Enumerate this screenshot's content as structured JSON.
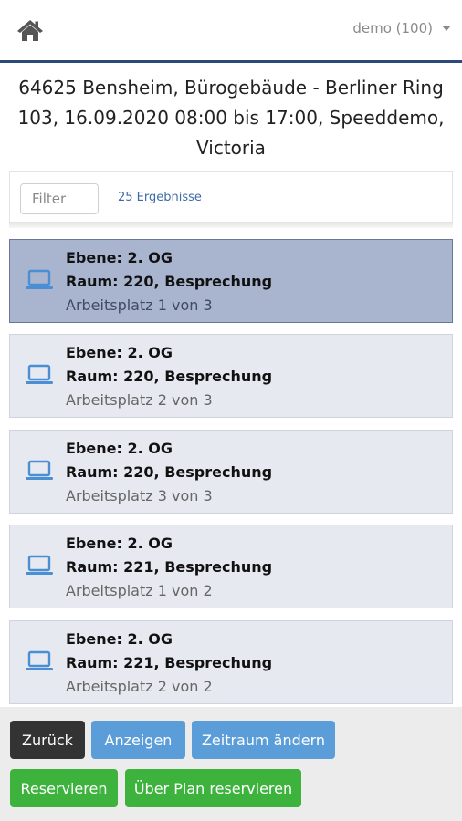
{
  "header": {
    "user_menu_label": "demo (100)"
  },
  "title": {
    "line1": "64625 Bensheim, Bürogebäude - Berliner Ring",
    "line2": "103, 16.09.2020 08:00 bis 17:00, Speeddemo,",
    "line3": "Victoria"
  },
  "filter": {
    "placeholder": "Filter",
    "value": "",
    "result_count": "25 Ergebnisse"
  },
  "workplaces": [
    {
      "ebene": "Ebene: 2. OG",
      "raum": "Raum: 220, Besprechung",
      "platz": "Arbeitsplatz 1 von 3",
      "selected": true
    },
    {
      "ebene": "Ebene: 2. OG",
      "raum": "Raum: 220, Besprechung",
      "platz": "Arbeitsplatz 2 von 3",
      "selected": false
    },
    {
      "ebene": "Ebene: 2. OG",
      "raum": "Raum: 220, Besprechung",
      "platz": "Arbeitsplatz 3 von 3",
      "selected": false
    },
    {
      "ebene": "Ebene: 2. OG",
      "raum": "Raum: 221, Besprechung",
      "platz": "Arbeitsplatz 1 von 2",
      "selected": false
    },
    {
      "ebene": "Ebene: 2. OG",
      "raum": "Raum: 221, Besprechung",
      "platz": "Arbeitsplatz 2 von 2",
      "selected": false
    }
  ],
  "actions": {
    "back": "Zurück",
    "show": "Anzeigen",
    "change_period": "Zeitraum ändern",
    "reserve": "Reservieren",
    "reserve_via_plan": "Über Plan reservieren"
  },
  "colors": {
    "accent_line": "#2b4a7a",
    "icon_blue": "#4a8fd4",
    "selected_bg": "#a9b4cf",
    "card_bg": "#e7e9f0",
    "button_dark": "#333333",
    "button_blue": "#5b9dd9",
    "button_green": "#3db33d"
  },
  "icons": {
    "home": "home-icon",
    "dropdown": "caret-down-icon",
    "workplace": "laptop-icon"
  }
}
